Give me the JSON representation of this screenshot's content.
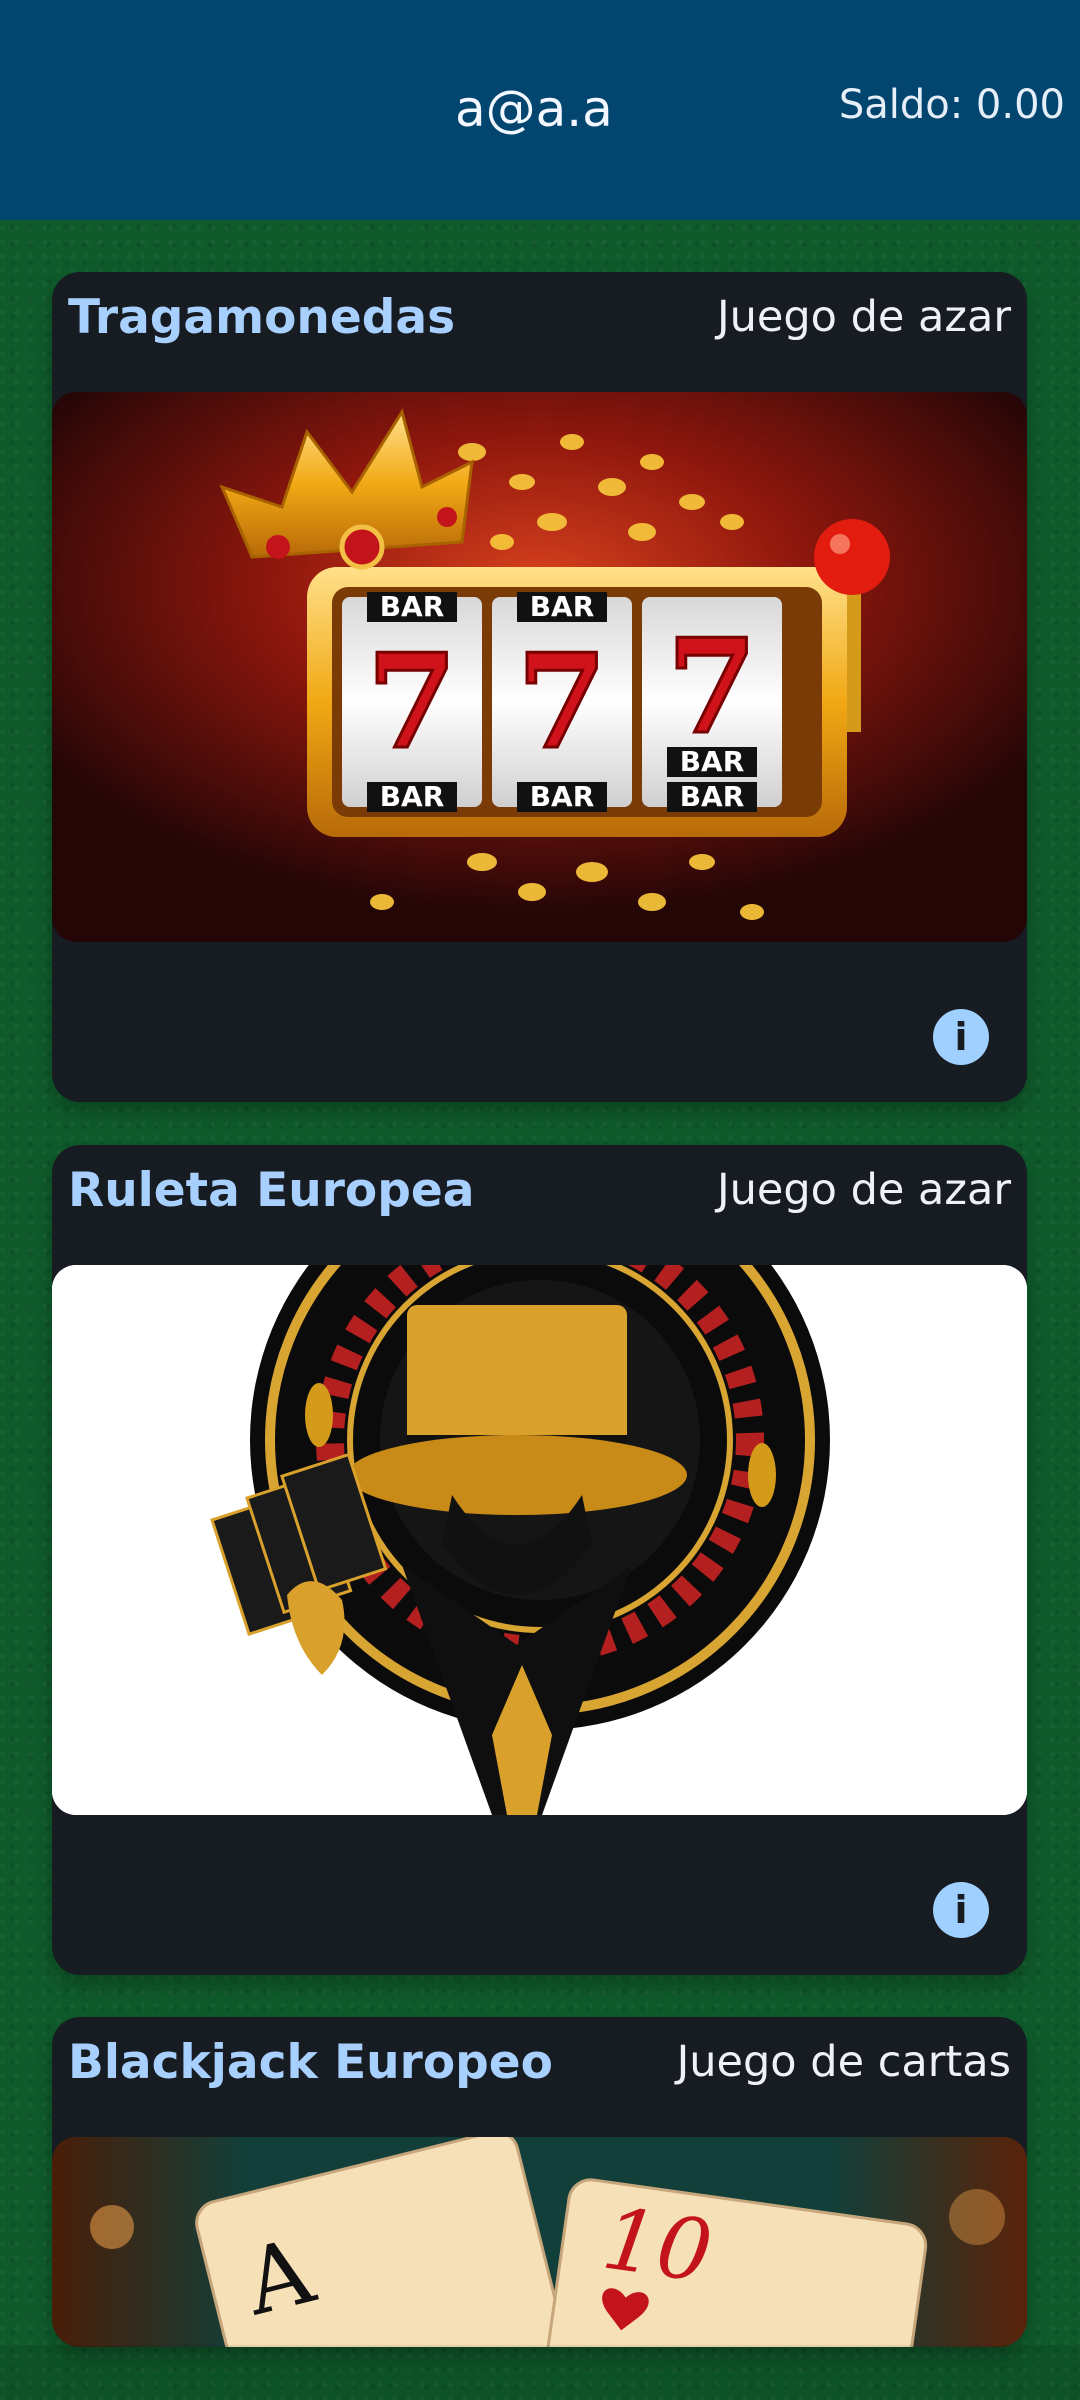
{
  "header": {
    "user": "a@a.a",
    "balance": "Saldo: 0.00"
  },
  "games": [
    {
      "title": "Tragamonedas",
      "type": "Juego de azar",
      "info_icon": "info-icon",
      "image": "slot-machine-777"
    },
    {
      "title": "Ruleta Europea",
      "type": "Juego de azar",
      "info_icon": "info-icon",
      "image": "roulette-wheel-top-hat"
    },
    {
      "title": "Blackjack Europeo",
      "type": "Juego de cartas",
      "image": "blackjack-cards"
    }
  ],
  "slot_image": {
    "bar": "BAR",
    "seven": "7"
  },
  "blackjack_image": {
    "card1": "A",
    "card2": "10"
  }
}
